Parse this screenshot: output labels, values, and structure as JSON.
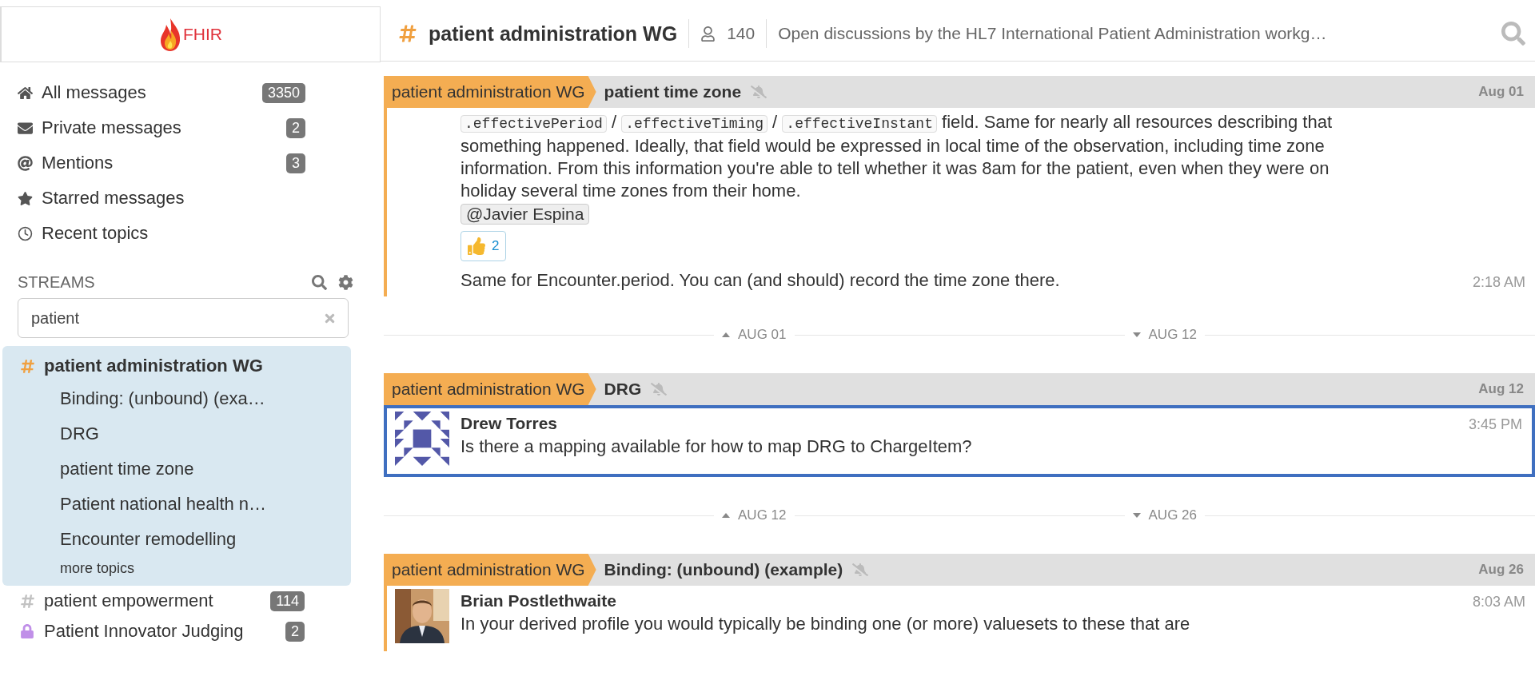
{
  "logo": {
    "text": "FHIR"
  },
  "header": {
    "stream": "patient administration WG",
    "subscribers": "140",
    "description": "Open discussions by the HL7 International Patient Administration workg…"
  },
  "sidebar": {
    "views": [
      {
        "kind": "home",
        "label": "All messages",
        "count": "3350"
      },
      {
        "kind": "mail",
        "label": "Private messages",
        "count": "2"
      },
      {
        "kind": "at",
        "label": "Mentions",
        "count": "3"
      },
      {
        "kind": "star",
        "label": "Starred messages"
      },
      {
        "kind": "clock",
        "label": "Recent topics"
      }
    ],
    "streams_heading": "STREAMS",
    "stream_filter": {
      "value": "patient"
    },
    "streams": [
      {
        "kind": "public",
        "name": "patient administration WG",
        "color": "#f0a040",
        "selected": true,
        "topics": [
          "Binding: (unbound) (exa…",
          "DRG",
          "patient time zone",
          "Patient national health n…",
          "Encounter remodelling"
        ],
        "more": "more topics"
      },
      {
        "kind": "public",
        "name": "patient empowerment",
        "color": "#c2c2c2",
        "selected": false,
        "count": "114"
      },
      {
        "kind": "private",
        "name": "Patient Innovator Judging",
        "color": "#c08fe8",
        "selected": false,
        "count": "2"
      }
    ]
  },
  "feed": [
    {
      "kind": "group",
      "stream": "patient administration WG",
      "color": "#f4ad52",
      "topic": "patient time zone",
      "date": "Aug 01",
      "selected": false,
      "messages": [
        {
          "parts": [
            {
              "kind": "code",
              "text": ".effectivePeriod"
            },
            {
              "kind": "text",
              "text": " / "
            },
            {
              "kind": "code",
              "text": ".effectiveTiming"
            },
            {
              "kind": "text",
              "text": " / "
            },
            {
              "kind": "code",
              "text": ".effectiveInstant"
            },
            {
              "kind": "text",
              "text": " field. Same for nearly all resources describing that something happened. Ideally, that field would be expressed in local time of the observation, including time zone information. From this information you're able to tell whether it was 8am for the patient, even when they were on holiday several time zones from their home."
            }
          ],
          "mention": "@Javier Espina",
          "reaction": {
            "count": "2"
          }
        },
        {
          "parts": [
            {
              "kind": "text",
              "text": "Same for Encounter.period. You can (and should) record the time zone there."
            }
          ],
          "time": "2:18 AM"
        }
      ]
    },
    {
      "kind": "divider",
      "left": "AUG 01",
      "right": "AUG 12"
    },
    {
      "kind": "group",
      "stream": "patient administration WG",
      "color": "#f4ad52",
      "topic": "DRG",
      "date": "Aug 12",
      "selected": true,
      "messages": [
        {
          "sender": "Drew Torres",
          "avatar": {
            "kind": "pattern"
          },
          "time": "3:45 PM",
          "parts": [
            {
              "kind": "text",
              "text": "Is there a mapping available for how to map DRG to ChargeItem?"
            }
          ]
        }
      ]
    },
    {
      "kind": "divider",
      "left": "AUG 12",
      "right": "AUG 26"
    },
    {
      "kind": "group",
      "stream": "patient administration WG",
      "color": "#f4ad52",
      "topic": "Binding: (unbound) (example)",
      "date": "Aug 26",
      "selected": false,
      "messages": [
        {
          "sender": "Brian Postlethwaite",
          "avatar": {
            "kind": "picture"
          },
          "time": "8:03 AM",
          "parts": [
            {
              "kind": "text",
              "text": "In your derived profile you would typically be binding one (or more) valuesets to these that are"
            }
          ]
        }
      ]
    }
  ]
}
